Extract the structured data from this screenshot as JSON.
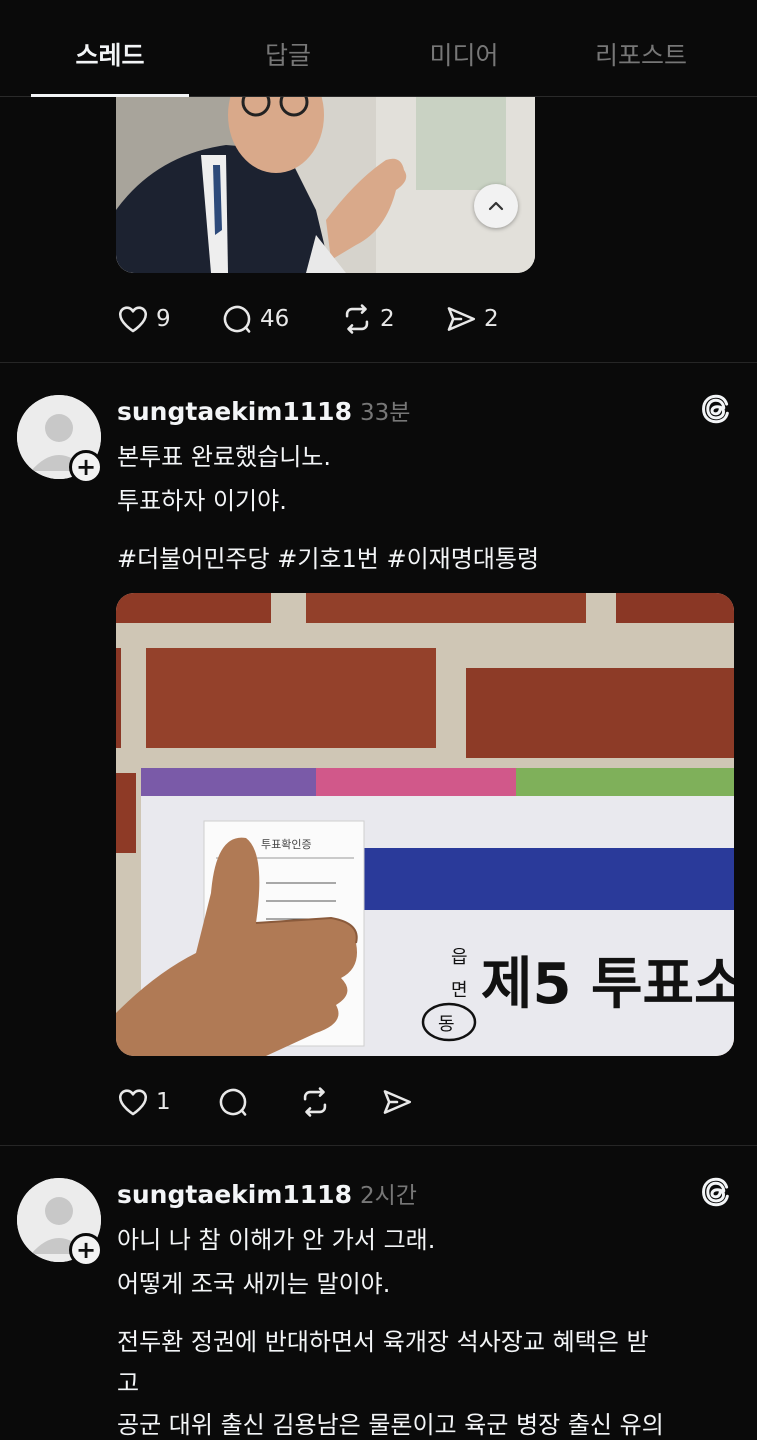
{
  "tabs": [
    {
      "label": "스레드",
      "active": true
    },
    {
      "label": "답글",
      "active": false
    },
    {
      "label": "미디어",
      "active": false
    },
    {
      "label": "리포스트",
      "active": false
    }
  ],
  "post1": {
    "likes": "9",
    "replies": "46",
    "reposts": "2",
    "shares": "2"
  },
  "post2": {
    "username": "sungtaekim1118",
    "time": "33분",
    "lines": [
      "본투표 완료했습니노.",
      "투표하자 이기야."
    ],
    "hashtags": "#더불어민주당 #기호1번 #이재명대통령",
    "image": {
      "voucher_title": "투표확인증",
      "sign_top": "읍",
      "sign_mid": "면",
      "sign_bottom": "동",
      "sign_text": "제5 투표소"
    },
    "likes": "1"
  },
  "post3": {
    "username": "sungtaekim1118",
    "time": "2시간",
    "lines": [
      "아니 나 참 이해가 안 가서 그래.",
      "어떻게 조국 새끼는 말이야.",
      "전두환 정권에 반대하면서 육개장 석사장교 혜택은 받",
      "고",
      "공군 대위 출신 김용남은 물론이고 육군 병장 출신 유의"
    ]
  },
  "icons": {
    "heart": "heart-icon",
    "comment": "comment-icon",
    "repost": "repost-icon",
    "share": "share-icon",
    "threads": "threads-logo-icon",
    "collapse": "chevron-up-icon"
  }
}
